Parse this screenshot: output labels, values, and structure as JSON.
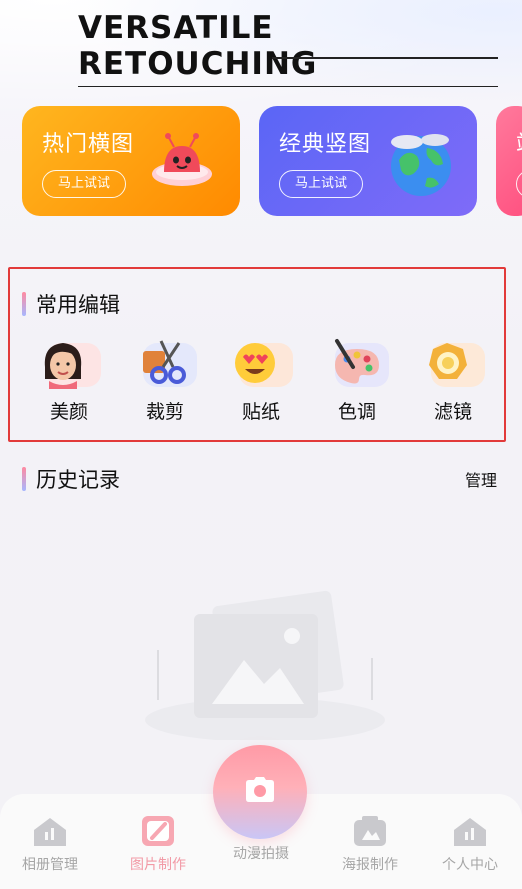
{
  "hero": {
    "title": "VERSATILE RETOUCHING"
  },
  "banners": [
    {
      "title": "热门横图",
      "button": "马上试试",
      "color": "#ff9800"
    },
    {
      "title": "经典竖图",
      "button": "马上试试",
      "color": "#6169f6"
    }
  ],
  "common_edit": {
    "title": "常用编辑",
    "tools": [
      {
        "label": "美颜",
        "icon": "beauty-face-icon"
      },
      {
        "label": "裁剪",
        "icon": "scissors-icon"
      },
      {
        "label": "贴纸",
        "icon": "heart-eyes-sticker-icon"
      },
      {
        "label": "色调",
        "icon": "paint-palette-icon"
      },
      {
        "label": "滤镜",
        "icon": "camera-lens-filter-icon"
      }
    ]
  },
  "history": {
    "title": "历史记录",
    "manage_label": "管理"
  },
  "tabbar": {
    "tabs": [
      {
        "label": "相册管理",
        "icon": "album-house-icon",
        "active": false
      },
      {
        "label": "图片制作",
        "icon": "image-edit-icon",
        "active": true
      },
      {
        "label": "动漫拍摄",
        "icon": "camera-icon",
        "active": false
      },
      {
        "label": "海报制作",
        "icon": "poster-icon",
        "active": false
      },
      {
        "label": "个人中心",
        "icon": "profile-house-icon",
        "active": false
      }
    ]
  },
  "colors": {
    "accent": "#f29aa6",
    "highlight_border": "#e23a3a"
  }
}
